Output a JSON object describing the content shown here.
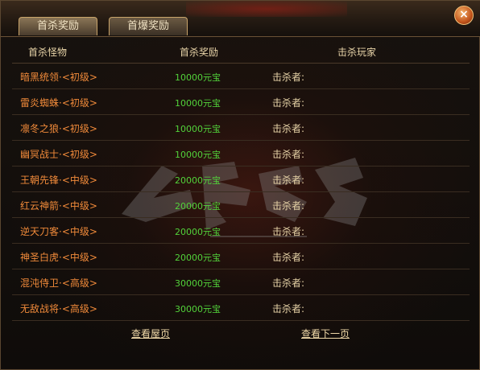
{
  "tabs": [
    {
      "label": "首杀奖励",
      "active": true
    },
    {
      "label": "首爆奖励",
      "active": false
    }
  ],
  "close_label": "×",
  "columns": [
    "首杀怪物",
    "首杀奖励",
    "击杀玩家"
  ],
  "rows": [
    {
      "monster": "暗黑统领·<初级>",
      "reward": "10000元宝",
      "killer": "击杀者:"
    },
    {
      "monster": "雷炎蜘蛛·<初级>",
      "reward": "10000元宝",
      "killer": "击杀者:"
    },
    {
      "monster": "凛冬之狼·<初级>",
      "reward": "10000元宝",
      "killer": "击杀者:"
    },
    {
      "monster": "幽冥战士·<初级>",
      "reward": "10000元宝",
      "killer": "击杀者:"
    },
    {
      "monster": "王朝先锋·<中级>",
      "reward": "20000元宝",
      "killer": "击杀者:"
    },
    {
      "monster": "红云神箭·<中级>",
      "reward": "20000元宝",
      "killer": "击杀者:"
    },
    {
      "monster": "逆天刀客·<中级>",
      "reward": "20000元宝",
      "killer": "击杀者:"
    },
    {
      "monster": "神圣白虎·<中级>",
      "reward": "20000元宝",
      "killer": "击杀者:"
    },
    {
      "monster": "混沌侍卫·<高级>",
      "reward": "30000元宝",
      "killer": "击杀者:"
    },
    {
      "monster": "无敌战将·<高级>",
      "reward": "30000元宝",
      "killer": "击杀者:"
    }
  ],
  "pager": {
    "first": "查看屋页",
    "next": "查看下一页"
  },
  "colors": {
    "monster": "#f08a3a",
    "reward": "#52d23a",
    "text": "#e8d4a8"
  }
}
